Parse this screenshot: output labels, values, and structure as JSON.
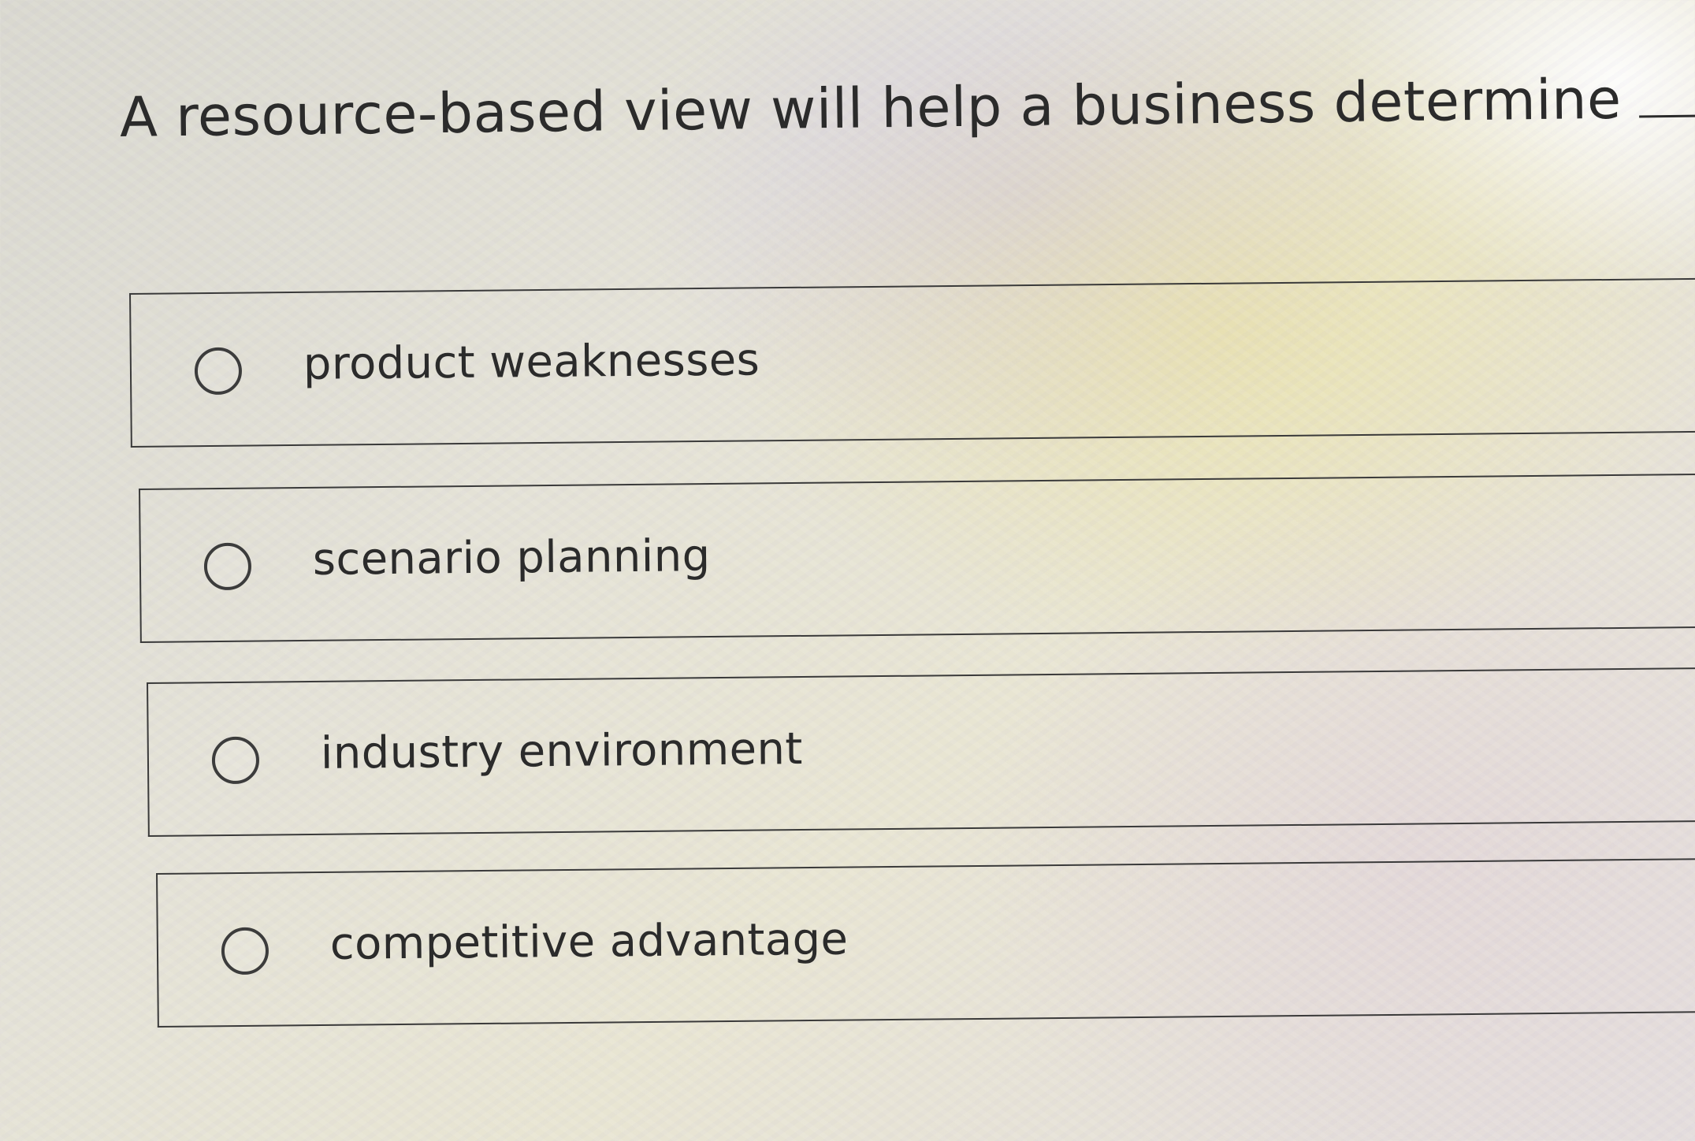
{
  "question": {
    "text": "A resource-based view will help a business determine",
    "trailing_punctuation": "."
  },
  "options": [
    {
      "label": "product weaknesses",
      "selected": false
    },
    {
      "label": "scenario planning",
      "selected": false
    },
    {
      "label": "industry environment",
      "selected": false
    },
    {
      "label": "competitive advantage",
      "selected": false
    }
  ]
}
